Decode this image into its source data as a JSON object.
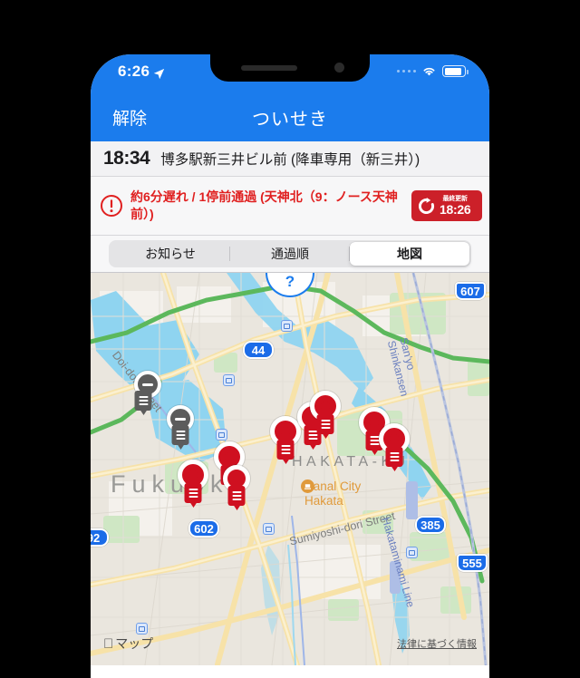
{
  "status_bar": {
    "time": "6:26",
    "location_icon": "location-arrow-icon",
    "wifi_icon": "wifi-icon",
    "battery_icon": "battery-icon"
  },
  "nav_bar": {
    "back_label": "解除",
    "title": "ついせき"
  },
  "destination": {
    "time": "18:34",
    "name": "博多駅新三井ビル前 (降車専用（新三井）)"
  },
  "alert": {
    "icon": "warning-exclamation-icon",
    "text": "約6分遅れ / 1停前通過 (天神北（9：ノース天神前）)",
    "refresh": {
      "icon": "refresh-circular-arrow-icon",
      "label": "最終更新",
      "time": "18:26",
      "color": "#cc2029"
    }
  },
  "segmented_control": {
    "options": [
      {
        "label": "お知らせ",
        "selected": false
      },
      {
        "label": "通過順",
        "selected": false
      },
      {
        "label": "地図",
        "selected": true
      }
    ]
  },
  "map": {
    "help_button": "?",
    "attribution": "マップ",
    "legal_link": "法律に基づく情報",
    "labels": {
      "city": "Fukuoka",
      "ward": "HAKATA-KU",
      "poi": "Canal City\nHakata",
      "street_1": "Doi-dori Street",
      "street_2": "Sumiyoshi-dori Street",
      "rail_1": "San'yo Shinkansen",
      "rail_2": "Hakataminami Line"
    },
    "route_shields": [
      "44",
      "607",
      "602",
      "385",
      "555"
    ],
    "stops": [
      {
        "type": "active",
        "label": "bus-stop-marker"
      },
      {
        "type": "active",
        "label": "bus-stop-marker"
      },
      {
        "type": "active",
        "label": "bus-stop-marker"
      },
      {
        "type": "active",
        "label": "bus-stop-marker"
      },
      {
        "type": "active",
        "label": "bus-stop-marker"
      },
      {
        "type": "active",
        "label": "bus-stop-marker"
      },
      {
        "type": "active",
        "label": "bus-stop-marker"
      },
      {
        "type": "active",
        "label": "bus-stop-marker"
      },
      {
        "type": "passed",
        "label": "bus-stop-marker-passed"
      },
      {
        "type": "passed",
        "label": "bus-stop-marker-passed"
      }
    ],
    "colors": {
      "land": "#f2efe9",
      "water": "#8fd4f0",
      "park": "#cfe7c4",
      "road": "#f7e2a8",
      "highway": "#5cb85c",
      "accent": "#1b7ced",
      "marker": "#cf1020"
    }
  }
}
